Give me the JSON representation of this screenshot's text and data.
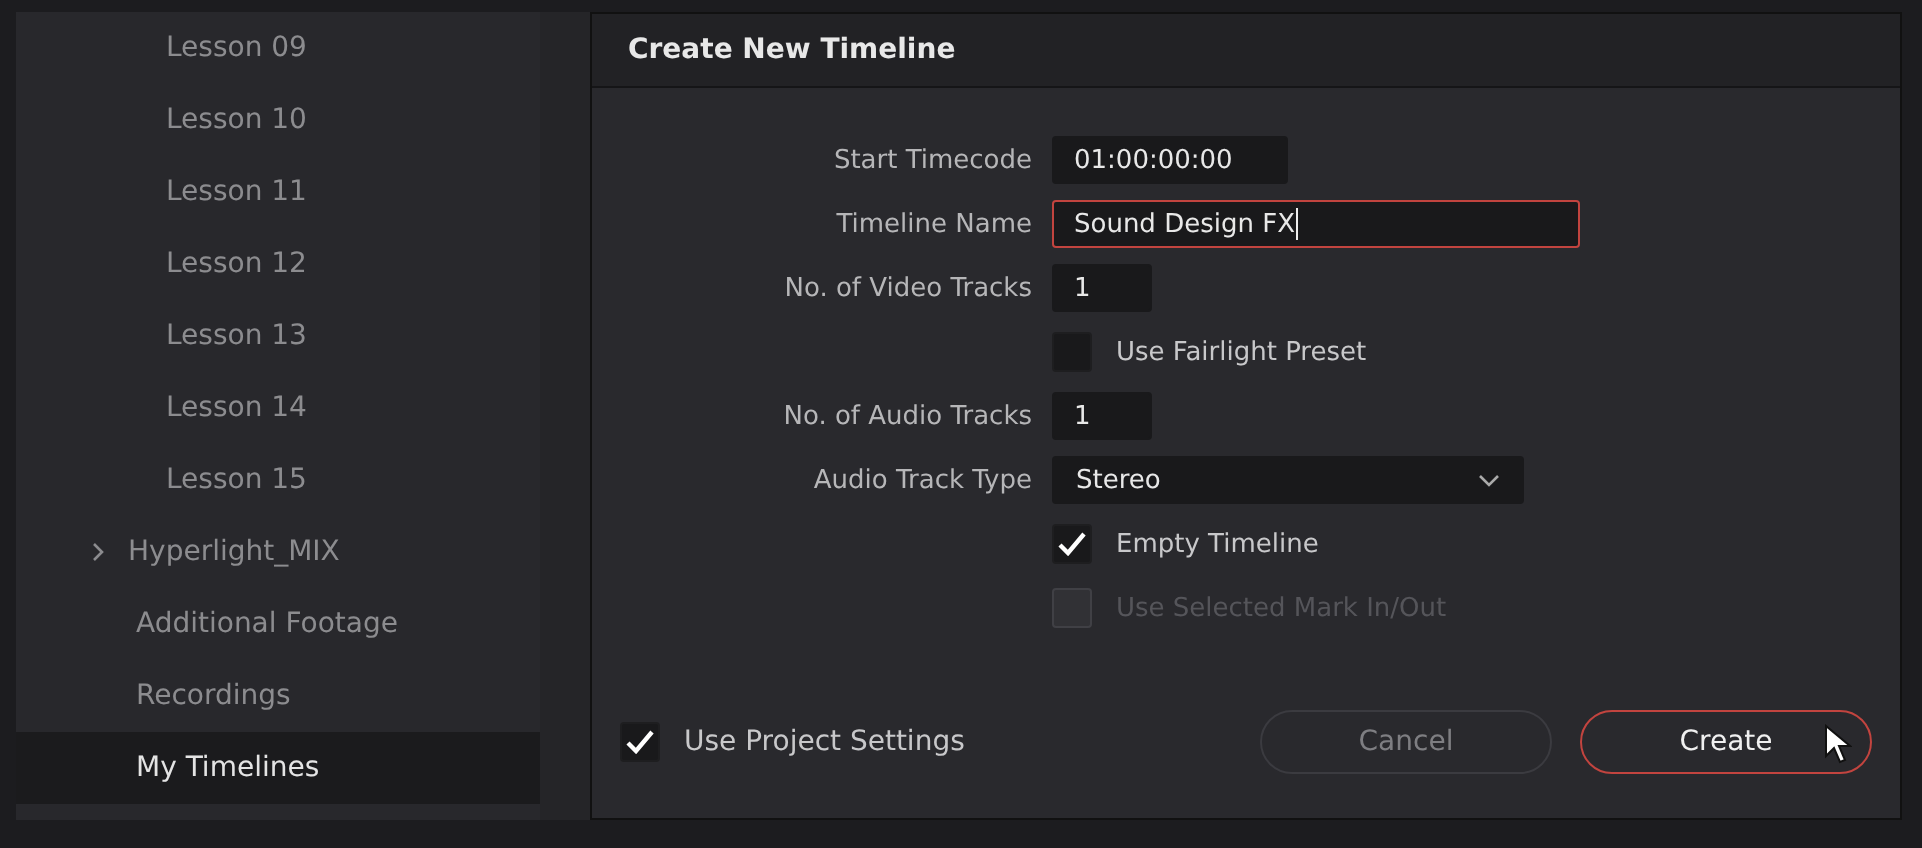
{
  "sidebar": {
    "items": [
      {
        "label": "Lesson 09",
        "kind": "child",
        "selected": false
      },
      {
        "label": "Lesson 10",
        "kind": "child",
        "selected": false
      },
      {
        "label": "Lesson 11",
        "kind": "child",
        "selected": false
      },
      {
        "label": "Lesson 12",
        "kind": "child",
        "selected": false
      },
      {
        "label": "Lesson 13",
        "kind": "child",
        "selected": false
      },
      {
        "label": "Lesson 14",
        "kind": "child",
        "selected": false
      },
      {
        "label": "Lesson 15",
        "kind": "child",
        "selected": false
      },
      {
        "label": "Hyperlight_MIX",
        "kind": "collapsed",
        "selected": false
      },
      {
        "label": "Additional Footage",
        "kind": "bin",
        "selected": false
      },
      {
        "label": "Recordings",
        "kind": "bin",
        "selected": false
      },
      {
        "label": "My Timelines",
        "kind": "bin",
        "selected": true
      }
    ]
  },
  "dialog": {
    "title": "Create New Timeline",
    "rows": [
      {
        "kind": "timecode",
        "label": "Start Timecode",
        "value": "01:00:00:00",
        "focused": false
      },
      {
        "kind": "text",
        "label": "Timeline Name",
        "value": "Sound Design FX",
        "focused": true
      },
      {
        "kind": "number",
        "label": "No. of Video Tracks",
        "value": "1",
        "focused": false
      },
      {
        "kind": "checkbox",
        "label": "Use Fairlight Preset",
        "checked": false,
        "disabled": false
      },
      {
        "kind": "number",
        "label": "No. of Audio Tracks",
        "value": "1",
        "focused": false
      },
      {
        "kind": "dropdown",
        "label": "Audio Track Type",
        "value": "Stereo"
      },
      {
        "kind": "checkbox",
        "label": "Empty Timeline",
        "checked": true,
        "disabled": false
      },
      {
        "kind": "checkbox",
        "label": "Use Selected Mark In/Out",
        "checked": false,
        "disabled": true
      }
    ],
    "project_settings": {
      "label": "Use Project Settings",
      "checked": true
    },
    "buttons": [
      {
        "label": "Cancel",
        "kind": "secondary"
      },
      {
        "label": "Create",
        "kind": "primary"
      }
    ]
  }
}
